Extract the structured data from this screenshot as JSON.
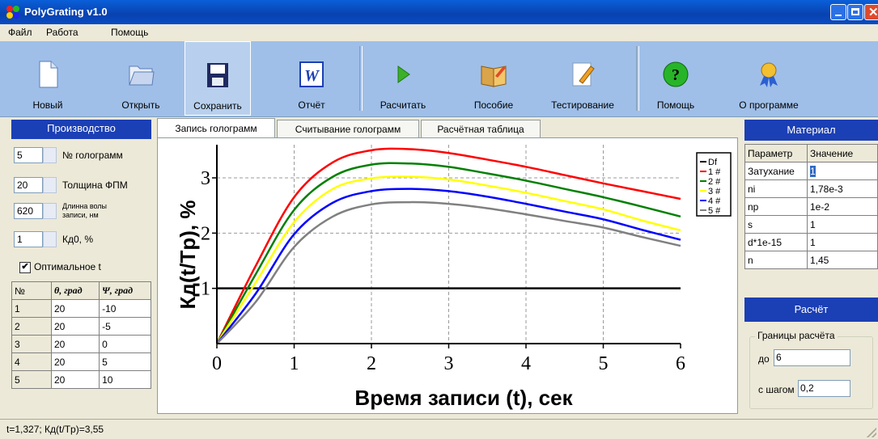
{
  "window": {
    "title": "PolyGrating v1.0"
  },
  "menu": [
    "Файл",
    "Работа",
    "Помощь"
  ],
  "toolbar": {
    "buttons": [
      {
        "label": "Новый",
        "icon": "new-document-icon"
      },
      {
        "label": "Открыть",
        "icon": "open-folder-icon"
      },
      {
        "label": "Сохранить",
        "icon": "save-floppy-icon"
      },
      {
        "label": "Отчёт",
        "icon": "word-report-icon"
      },
      {
        "label": "Расчитать",
        "icon": "play-triangle-icon"
      },
      {
        "label": "Пособие",
        "icon": "book-icon"
      },
      {
        "label": "Тестирование",
        "icon": "test-pencil-icon"
      },
      {
        "label": "Помощь",
        "icon": "help-question-icon"
      },
      {
        "label": "О программе",
        "icon": "award-ribbon-icon"
      }
    ]
  },
  "left": {
    "header": "Производство",
    "spinners": [
      {
        "value": "5",
        "label": "№ голограмм"
      },
      {
        "value": "20",
        "label": "Толщина ФПМ"
      },
      {
        "value": "620",
        "label": "Длинна волы записи, нм"
      },
      {
        "value": "1",
        "label": "Кд0, %"
      }
    ],
    "optimal_label": "Оптимальное t",
    "optimal_checked": "✔",
    "table": {
      "headers": [
        "№",
        "θ, град",
        "Ψ, град"
      ],
      "rows": [
        [
          "1",
          "20",
          "-10"
        ],
        [
          "2",
          "20",
          "-5"
        ],
        [
          "3",
          "20",
          "0"
        ],
        [
          "4",
          "20",
          "5"
        ],
        [
          "5",
          "20",
          "10"
        ]
      ]
    }
  },
  "tabs": [
    "Запись голограмм",
    "Считывание голограмм",
    "Расчётная таблица"
  ],
  "chart_data": {
    "type": "line",
    "title": "",
    "xlabel": "Время записи (t), сек",
    "ylabel": "Кд(t/Tp), %",
    "xlim": [
      0,
      6
    ],
    "ylim": [
      0,
      3.6
    ],
    "xticks": [
      "0",
      "1",
      "2",
      "3",
      "4",
      "5",
      "6"
    ],
    "yticks": [
      "1",
      "2",
      "3"
    ],
    "x": [
      0,
      0.5,
      1,
      1.5,
      2,
      2.5,
      3,
      3.5,
      4,
      4.5,
      5,
      5.5,
      6
    ],
    "series": [
      {
        "name": "Df",
        "color": "#000000",
        "values": [
          1,
          1,
          1,
          1,
          1,
          1,
          1,
          1,
          1,
          1,
          1,
          1,
          1
        ]
      },
      {
        "name": "1 #",
        "color": "#ff0000",
        "values": [
          0,
          1.4,
          2.65,
          3.28,
          3.5,
          3.52,
          3.45,
          3.33,
          3.2,
          3.05,
          2.9,
          2.76,
          2.62
        ]
      },
      {
        "name": "2 #",
        "color": "#008000",
        "values": [
          0,
          1.25,
          2.42,
          3.02,
          3.24,
          3.26,
          3.2,
          3.08,
          2.95,
          2.8,
          2.65,
          2.48,
          2.3
        ]
      },
      {
        "name": "3 #",
        "color": "#ffff00",
        "values": [
          0,
          1.1,
          2.2,
          2.8,
          2.99,
          3.02,
          2.97,
          2.86,
          2.73,
          2.58,
          2.43,
          2.23,
          2.05
        ]
      },
      {
        "name": "4 #",
        "color": "#0000ff",
        "values": [
          0,
          0.9,
          1.98,
          2.55,
          2.76,
          2.8,
          2.76,
          2.66,
          2.53,
          2.39,
          2.25,
          2.06,
          1.88
        ]
      },
      {
        "name": "5 #",
        "color": "#808080",
        "values": [
          0,
          0.75,
          1.75,
          2.3,
          2.52,
          2.56,
          2.53,
          2.45,
          2.34,
          2.22,
          2.1,
          1.93,
          1.77
        ]
      }
    ]
  },
  "right": {
    "header": "Материал",
    "table": {
      "headers": [
        "Параметр",
        "Значение"
      ],
      "rows": [
        [
          "Затухание",
          "1"
        ],
        [
          "ni",
          "1,78e-3"
        ],
        [
          "np",
          "1e-2"
        ],
        [
          "s",
          "1"
        ],
        [
          "d*1e-15",
          "1"
        ],
        [
          "n",
          "1,45"
        ]
      ]
    },
    "calc_header": "Расчёт",
    "bounds_label": "Границы расчёта",
    "to_label": "до",
    "to_value": "6",
    "step_label": "с шагом",
    "step_value": "0,2"
  },
  "status": {
    "text": "t=1,327; Кд(t/Tp)=3,55"
  },
  "colors": {
    "title": "#0842b0",
    "toolbar": "#9fbfe8",
    "panel_header": "#1b3fb5"
  }
}
